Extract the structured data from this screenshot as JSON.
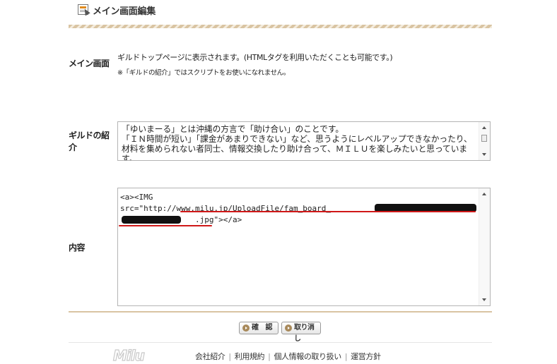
{
  "header": {
    "title": "メイン画面編集"
  },
  "rows": {
    "main_screen": {
      "label": "メイン画面",
      "help_line1": "ギルドトップページに表示されます。(HTMLタグを利用いただくことも可能です。)",
      "help_line2": "※「ギルドの紹介」ではスクリプトをお使いになれません。"
    },
    "guild_intro": {
      "label_line1": "ギルドの紹",
      "label_line2": "介",
      "value": "「ゆいまーる」とは沖縄の方言で「助け合い」のことです。\n「ＩＮ時間が短い」「課金があまりできない」など、思うようにレベルアップできなかったり、材料を集められない者同士、情報交換したり助け合って、ＭＩＬＵを楽しみたいと思っています。"
    },
    "content": {
      "label": "内容",
      "value": "<a><IMG\nsrc=\"http://www.milu.jp/UploadFile/fam_board_\n                .jpg\"></a>"
    }
  },
  "buttons": {
    "confirm": "確 認",
    "cancel": "取り消し"
  },
  "footer": {
    "logo": "Milu",
    "links": [
      "会社紹介",
      "利用規約",
      "個人情報の取り扱い",
      "運営方針"
    ]
  },
  "colors": {
    "stripe": "#d9c4a2",
    "underline": "#d01818"
  }
}
